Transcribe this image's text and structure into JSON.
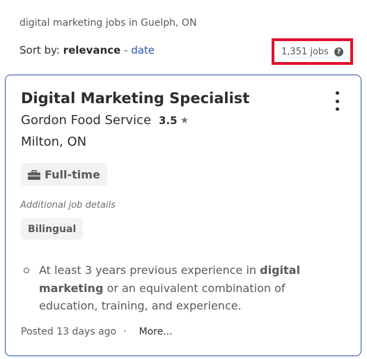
{
  "header": {
    "breadcrumb": "digital marketing jobs in Guelph, ON",
    "sort_label": "Sort by:",
    "sort_active": "relevance",
    "sort_separator": "-",
    "sort_alt": "date",
    "job_count": "1,351 jobs",
    "help_glyph": "?"
  },
  "job": {
    "title": "Digital Marketing Specialist",
    "company": "Gordon Food Service",
    "rating": "3.5",
    "rating_icon": "star-icon",
    "location": "Milton, ON",
    "job_type": "Full-time",
    "job_type_icon": "briefcase-icon",
    "details_label": "Additional job details",
    "detail_tag": "Bilingual",
    "snippet": {
      "part1": "At least 3 years previous experience in ",
      "bold1": "digital marketing",
      "part2": " or an equivalent combination of education, training, and experience."
    },
    "posted": "Posted 13 days ago",
    "footer_separator": "·",
    "more_label": "More..."
  },
  "colors": {
    "accent_blue": "#2557a7",
    "highlight_red": "#e0122b",
    "text_dark": "#2d2d2d",
    "text_muted": "#595959"
  }
}
